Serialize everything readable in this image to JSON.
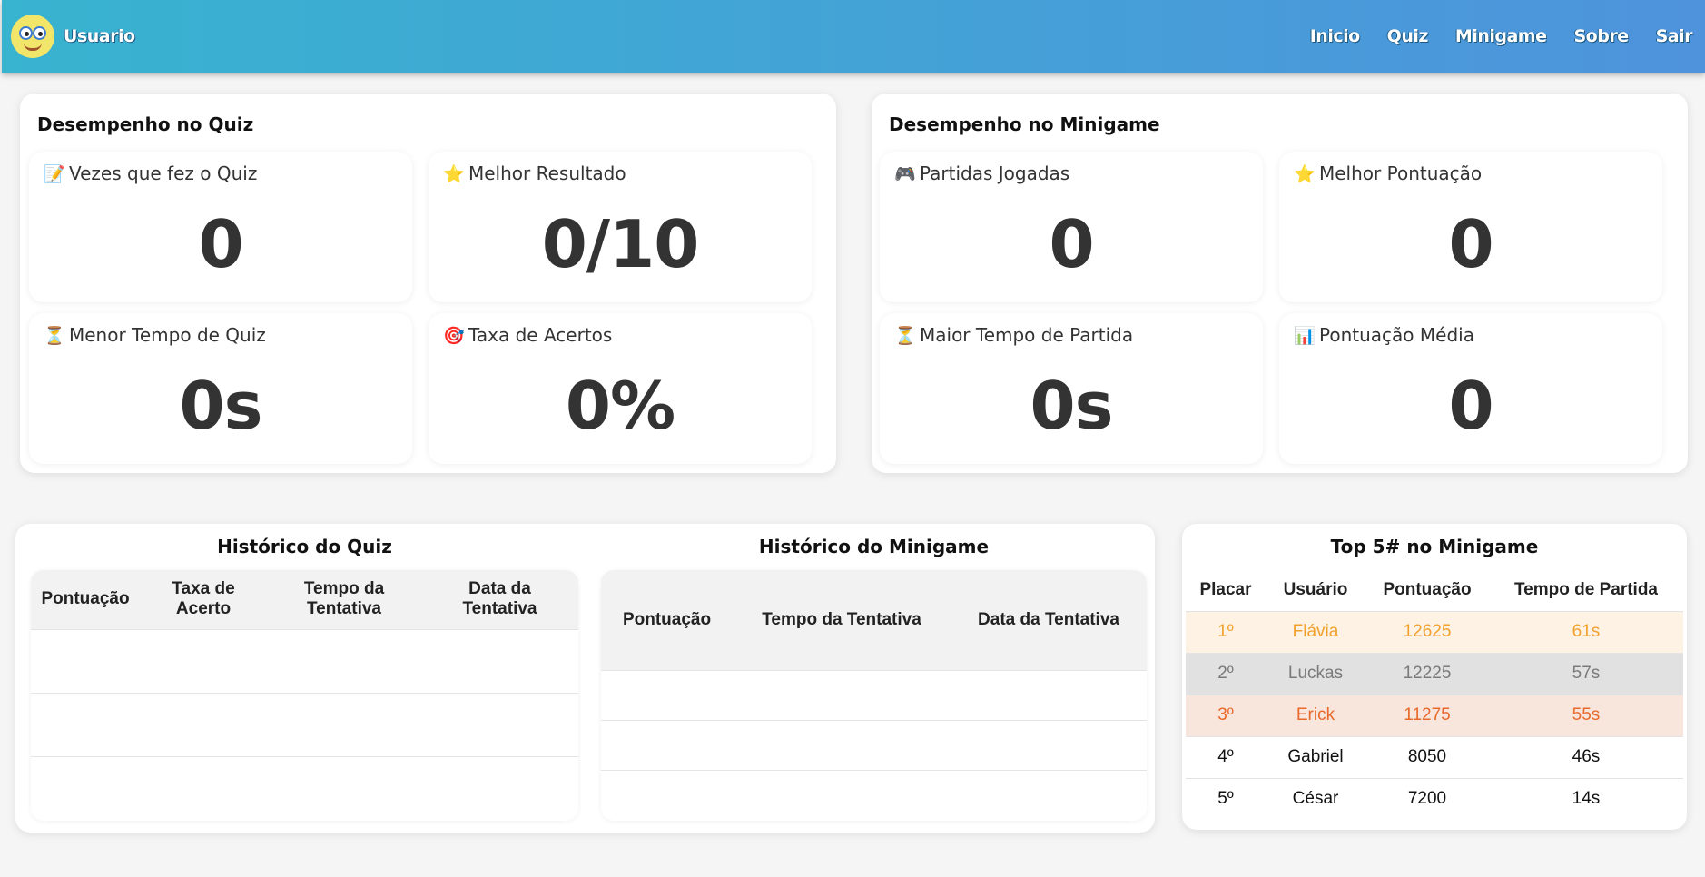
{
  "header": {
    "username": "Usuario",
    "nav": [
      "Inicio",
      "Quiz",
      "Minigame",
      "Sobre",
      "Sair"
    ]
  },
  "quiz_panel": {
    "title": "Desempenho no Quiz",
    "cards": [
      {
        "icon": "memo-icon",
        "glyph": "📝",
        "label": "Vezes que fez o Quiz",
        "value": "0"
      },
      {
        "icon": "star-icon",
        "glyph": "⭐",
        "label": "Melhor Resultado",
        "value": "0/10"
      },
      {
        "icon": "hourglass-icon",
        "glyph": "⏳",
        "label": "Menor Tempo de Quiz",
        "value": "0s"
      },
      {
        "icon": "target-icon",
        "glyph": "🎯",
        "label": "Taxa de Acertos",
        "value": "0%"
      }
    ]
  },
  "minigame_panel": {
    "title": "Desempenho no Minigame",
    "cards": [
      {
        "icon": "gamepad-icon",
        "glyph": "🎮",
        "label": "Partidas Jogadas",
        "value": "0"
      },
      {
        "icon": "star-icon",
        "glyph": "⭐",
        "label": "Melhor Pontuação",
        "value": "0"
      },
      {
        "icon": "hourglass-icon",
        "glyph": "⏳",
        "label": "Maior Tempo de Partida",
        "value": "0s"
      },
      {
        "icon": "bar-chart-icon",
        "glyph": "📊",
        "label": "Pontuação Média",
        "value": "0"
      }
    ]
  },
  "quiz_history": {
    "title": "Histórico do Quiz",
    "columns": [
      "Pontuação",
      "Taxa de Acerto",
      "Tempo da Tentativa",
      "Data da Tentativa"
    ]
  },
  "minigame_history": {
    "title": "Histórico do Minigame",
    "columns": [
      "Pontuação",
      "Tempo da Tentativa",
      "Data da Tentativa"
    ]
  },
  "top5": {
    "title": "Top 5# no Minigame",
    "columns": [
      "Placar",
      "Usuário",
      "Pontuação",
      "Tempo de Partida"
    ],
    "rows": [
      {
        "place": "1º",
        "user": "Flávia",
        "score": "12625",
        "time": "61s"
      },
      {
        "place": "2º",
        "user": "Luckas",
        "score": "12225",
        "time": "57s"
      },
      {
        "place": "3º",
        "user": "Erick",
        "score": "11275",
        "time": "55s"
      },
      {
        "place": "4º",
        "user": "Gabriel",
        "score": "8050",
        "time": "46s"
      },
      {
        "place": "5º",
        "user": "César",
        "score": "7200",
        "time": "14s"
      }
    ]
  },
  "colors": {
    "header_start": "#38b3d0",
    "header_end": "#4e93dc",
    "gold": "#f2a12e",
    "silver": "#7a7a7a",
    "bronze": "#e8692a"
  }
}
